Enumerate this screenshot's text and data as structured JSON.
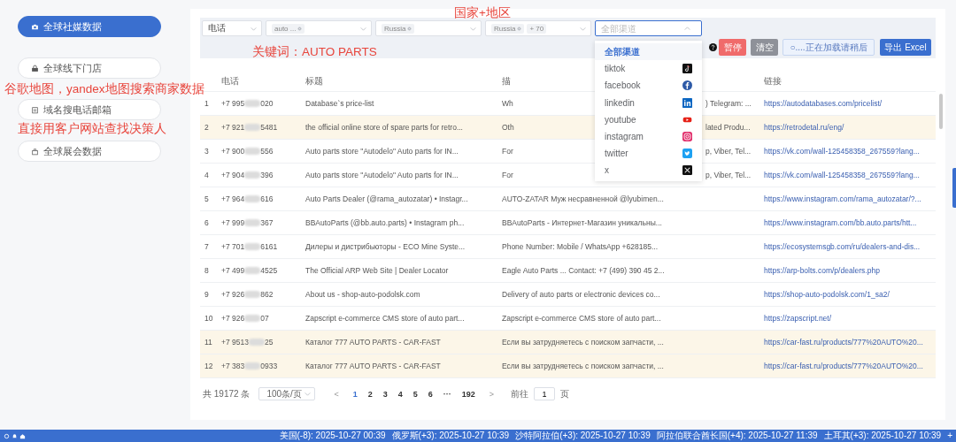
{
  "sidebar": {
    "items": [
      {
        "label": "全球社媒数据",
        "selected": true
      },
      {
        "label": "全球线下门店",
        "selected": false
      },
      {
        "label": "域名搜电话邮箱",
        "selected": false
      },
      {
        "label": "全球展会数据",
        "selected": false
      }
    ]
  },
  "annotations": [
    "国家+地区",
    "关键词：AUTO PARTS",
    "谷歌地图，yandex地图搜索商家数据",
    "直接用客户网站查找决策人"
  ],
  "filters": [
    {
      "kind": "value",
      "value": "电话"
    },
    {
      "kind": "tags",
      "tags": [
        "auto ..."
      ]
    },
    {
      "kind": "tags",
      "tags": [
        "Russia"
      ]
    },
    {
      "kind": "tags",
      "tags": [
        "Russia"
      ],
      "more": "+ 70"
    },
    {
      "kind": "search",
      "placeholder": "全部渠道",
      "expanded": true
    }
  ],
  "channel_menu": [
    {
      "label": "全部渠道",
      "selected": true
    },
    {
      "label": "tiktok",
      "selected": false
    },
    {
      "label": "facebook",
      "selected": false
    },
    {
      "label": "linkedin",
      "selected": false
    },
    {
      "label": "youtube",
      "selected": false
    },
    {
      "label": "instagram",
      "selected": false
    },
    {
      "label": "twitter",
      "selected": false
    },
    {
      "label": "x",
      "selected": false
    }
  ],
  "actions": [
    {
      "label": "暂停",
      "kind": "danger"
    },
    {
      "label": "清空",
      "kind": "muted"
    },
    {
      "label": "○....正在加载请稍后",
      "kind": "loading"
    },
    {
      "label": "导出 Excel",
      "kind": "primary"
    }
  ],
  "table": {
    "columns": [
      "电话",
      "标题",
      "描",
      "链接"
    ],
    "rows": [
      {
        "index": "1",
        "phone": "+7 995",
        "phone_end": "020",
        "title": "Database`s price-list",
        "desc": "Wh",
        "desc_end": ") Telegram: ...",
        "link": "https://autodatabases.com/pricelist/",
        "highlighted": false
      },
      {
        "index": "2",
        "phone": "+7 921",
        "phone_end": "5481",
        "title": "the official online store of spare parts for retro...",
        "desc": "Oth",
        "desc_end": "lated Produ...",
        "link": "https://retrodetal.ru/eng/",
        "highlighted": true
      },
      {
        "index": "3",
        "phone": "+7 900",
        "phone_end": "556",
        "title": "Auto parts store \"Autodelo\" Auto parts for IN...",
        "desc": "For",
        "desc_end": "p, Viber, Tel...",
        "link": "https://vk.com/wall-125458358_267559?lang...",
        "highlighted": false
      },
      {
        "index": "4",
        "phone": "+7 904",
        "phone_end": "396",
        "title": "Auto parts store \"Autodelo\" Auto parts for IN...",
        "desc": "For",
        "desc_end": "p, Viber, Tel...",
        "link": "https://vk.com/wall-125458358_267559?lang...",
        "highlighted": false
      },
      {
        "index": "5",
        "phone": "+7 964",
        "phone_end": "616",
        "title": "Auto Parts Dealer (@rama_autozatar) • Instagr...",
        "desc": "AUTO-ZATAR Муж несравненной @lyubimen...",
        "link": "https://www.instagram.com/rama_autozatar/?...",
        "highlighted": false
      },
      {
        "index": "6",
        "phone": "+7 999",
        "phone_end": "367",
        "title": "BBAutoParts (@bb.auto.parts) • Instagram ph...",
        "desc": "BBAutoParts - Интернет-Магазин уникальны...",
        "link": "https://www.instagram.com/bb.auto.parts/htt...",
        "highlighted": false
      },
      {
        "index": "7",
        "phone": "+7 701",
        "phone_end": "6161",
        "title": "Дилеры и дистрибьюторы - ECO Mine Syste...",
        "desc": "Phone Number: Mobile / WhatsApp +628185...",
        "link": "https://ecosystemsgb.com/ru/dealers-and-dis...",
        "highlighted": false
      },
      {
        "index": "8",
        "phone": "+7 499",
        "phone_end": "4525",
        "title": "The Official ARP Web Site | Dealer Locator",
        "desc": "Eagle Auto Parts ... Contact: +7 (499) 390 45 2...",
        "link": "https://arp-bolts.com/p/dealers.php",
        "highlighted": false
      },
      {
        "index": "9",
        "phone": "+7 926",
        "phone_end": "862",
        "title": "About us - shop-auto-podolsk.com",
        "desc": "Delivery of auto parts or electronic devices co...",
        "link": "https://shop-auto-podolsk.com/1_sa2/",
        "highlighted": false
      },
      {
        "index": "10",
        "phone": "+7 926",
        "phone_end": "07",
        "title": "Zapscript e-commerce CMS store of auto part...",
        "desc": "Zapscript e-commerce CMS store of auto part...",
        "link": "https://zapscript.net/",
        "highlighted": false
      },
      {
        "index": "11",
        "phone": "+7 9513",
        "phone_end": "25",
        "title": "Каталог 777 AUTO PARTS - CAR-FAST",
        "desc": "Если вы затрудняетесь с поиском запчасти, ...",
        "link": "https://car-fast.ru/products/777%20AUTO%20...",
        "highlighted": true
      },
      {
        "index": "12",
        "phone": "+7 383",
        "phone_end": "0933",
        "title": "Каталог 777 AUTO PARTS - CAR-FAST",
        "desc": "Если вы затрудняетесь с поиском запчасти, ...",
        "link": "https://car-fast.ru/products/777%20AUTO%20...",
        "highlighted": true
      }
    ]
  },
  "pagination": {
    "total": "共 19172 条",
    "page_size": "100条/页",
    "prev": "<",
    "pages": [
      {
        "label": "1",
        "selected": true
      },
      {
        "label": "2",
        "selected": false
      },
      {
        "label": "3",
        "selected": false
      },
      {
        "label": "4",
        "selected": false
      },
      {
        "label": "5",
        "selected": false
      },
      {
        "label": "6",
        "selected": false
      },
      {
        "label": "···",
        "selected": false
      },
      {
        "label": "192",
        "selected": false
      }
    ],
    "next": ">",
    "goto": "前往",
    "goto_value": "1",
    "page_unit": "页"
  },
  "status_bar": {
    "clocks": [
      "美国(-8): 2025-10-27 00:39",
      "俄罗斯(+3): 2025-10-27 10:39",
      "沙特阿拉伯(+3): 2025-10-27 10:39",
      "阿拉伯联合酋长国(+4): 2025-10-27 11:39",
      "土耳其(+3): 2025-10-27 10:39"
    ],
    "add": "+"
  }
}
